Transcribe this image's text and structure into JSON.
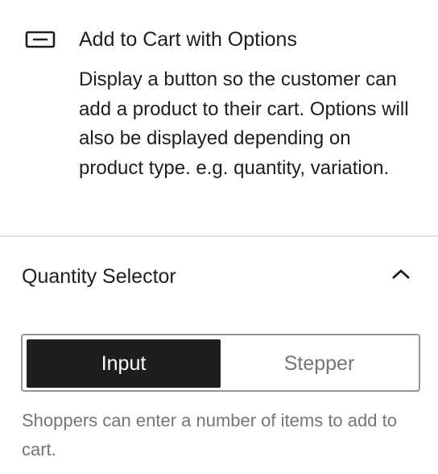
{
  "block": {
    "icon": "button-icon",
    "title": "Add to Cart with Options",
    "description": "Display a button so the customer can add a product to their cart. Options will also be displayed depending on product type. e.g. quantity, variation."
  },
  "panel": {
    "title": "Quantity Selector",
    "expanded": true,
    "chevron_icon": "chevron-up-icon"
  },
  "quantity_selector": {
    "options": [
      "Input",
      "Stepper"
    ],
    "selected": "Input",
    "help": "Shoppers can enter a number of items to add to cart."
  },
  "colors": {
    "text": "#1e1e1e",
    "muted": "#757575",
    "selected_bg": "#1e1e1e",
    "selected_text": "#ffffff",
    "border": "#949494",
    "divider": "#e0e0e0"
  }
}
